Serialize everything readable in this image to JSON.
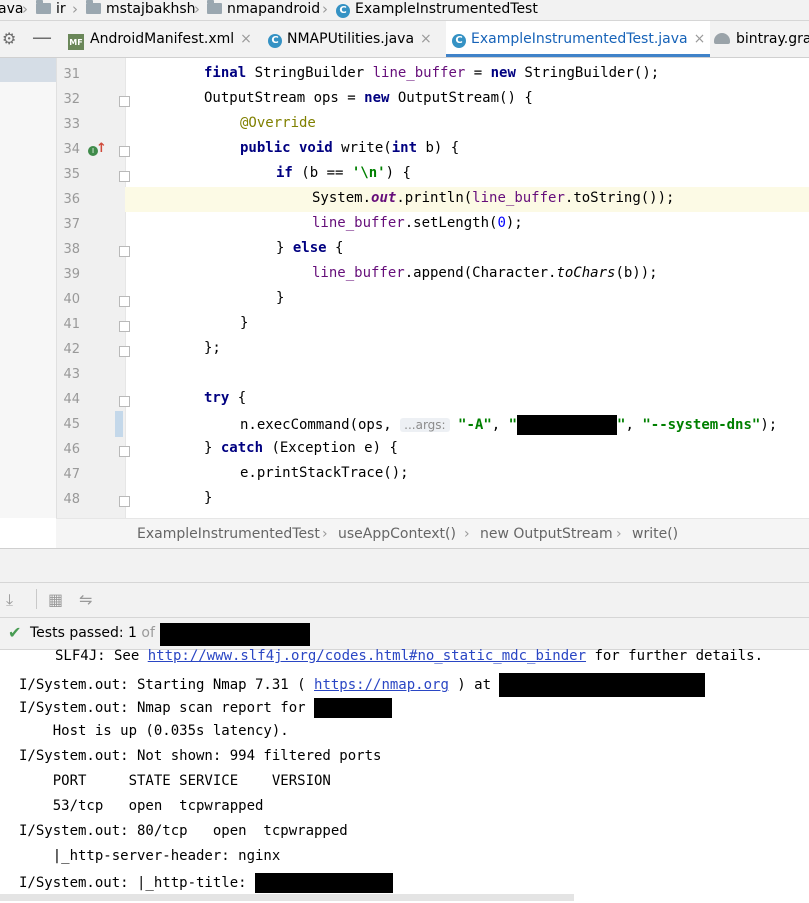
{
  "breadcrumbs": {
    "items": [
      "ava",
      "ir",
      "mstajbakhsh",
      "nmapandroid",
      "ExampleInstrumentedTest"
    ]
  },
  "tabs": [
    {
      "label": "AndroidManifest.xml",
      "icon": "manifest-file-icon"
    },
    {
      "label": "NMAPUtilities.java",
      "icon": "java-class-icon"
    },
    {
      "label": "ExampleInstrumentedTest.java",
      "icon": "java-test-class-icon",
      "active": true
    },
    {
      "label": "bintray.gra",
      "icon": "gradle-icon"
    }
  ],
  "editor": {
    "line_numbers": [
      "31",
      "32",
      "33",
      "34",
      "35",
      "36",
      "37",
      "38",
      "39",
      "40",
      "41",
      "42",
      "43",
      "44",
      "45",
      "46",
      "47",
      "48"
    ],
    "current_line": "36",
    "code": {
      "l31_a": "final",
      "l31_b": " StringBuilder ",
      "l31_c": "line_buffer",
      "l31_d": " = ",
      "l31_e": "new",
      "l31_f": " StringBuilder();",
      "l32_a": "OutputStream ops = ",
      "l32_b": "new",
      "l32_c": " OutputStream() {",
      "l33": "@Override",
      "l34_a": "public void",
      "l34_b": " write(",
      "l34_c": "int",
      "l34_d": " b) {",
      "l35_a": "if",
      "l35_b": " (b == ",
      "l35_c": "'\\n'",
      "l35_d": ") {",
      "l36_a": "System.",
      "l36_b": "out",
      "l36_c": ".println(",
      "l36_d": "line_buffer",
      "l36_e": ".toString());",
      "l37_a": "line_buffer",
      "l37_b": ".setLength(",
      "l37_c": "0",
      "l37_d": ");",
      "l38_a": "} ",
      "l38_b": "else",
      "l38_c": " {",
      "l39_a": "line_buffer",
      "l39_b": ".append(Character.",
      "l39_c": "toChars",
      "l39_d": "(b));",
      "l40": "}",
      "l41": "}",
      "l42": "};",
      "l44_a": "try",
      "l44_b": " {",
      "l45_a": "n.execCommand(ops, ",
      "l45_hint": "...args:",
      "l45_b": "\"-A\"",
      "l45_c": ", ",
      "l45_d": "\"",
      "l45_e": "\"",
      "l45_f": ", ",
      "l45_g": "\"--system-dns\"",
      "l45_h": ");",
      "l46_a": "} ",
      "l46_b": "catch",
      "l46_c": " (Exception e) {",
      "l47": "e.printStackTrace();",
      "l48": "}"
    }
  },
  "editor_breadcrumbs": [
    "ExampleInstrumentedTest",
    "useAppContext()",
    "new OutputStream",
    "write()"
  ],
  "test_status": {
    "label": "Tests passed:",
    "count": "1",
    "of": "of 1"
  },
  "console": {
    "l1_a": "SLF4J: See ",
    "l1_link": "http://www.slf4j.org/codes.html#no_static_mdc_binder",
    "l1_b": " for further details.",
    "l2_a": "I/System.out: Starting Nmap 7.31 ( ",
    "l2_link": "https://nmap.org",
    "l2_b": " ) at ",
    "l3": "I/System.out: Nmap scan report for ",
    "l4": "    Host is up (0.035s latency).",
    "l5": "I/System.out: Not shown: 994 filtered ports",
    "l6": "    PORT     STATE SERVICE    VERSION",
    "l7": "    53/tcp   open  tcpwrapped",
    "l8": "I/System.out: 80/tcp   open  tcpwrapped",
    "l9": "    |_http-server-header: nginx",
    "l10": "I/System.out: |_http-title: "
  },
  "colors": {
    "accent": "#4083c9",
    "pass_green": "#499c54",
    "keyword": "#000080",
    "string": "#008000",
    "field": "#660e7a"
  }
}
